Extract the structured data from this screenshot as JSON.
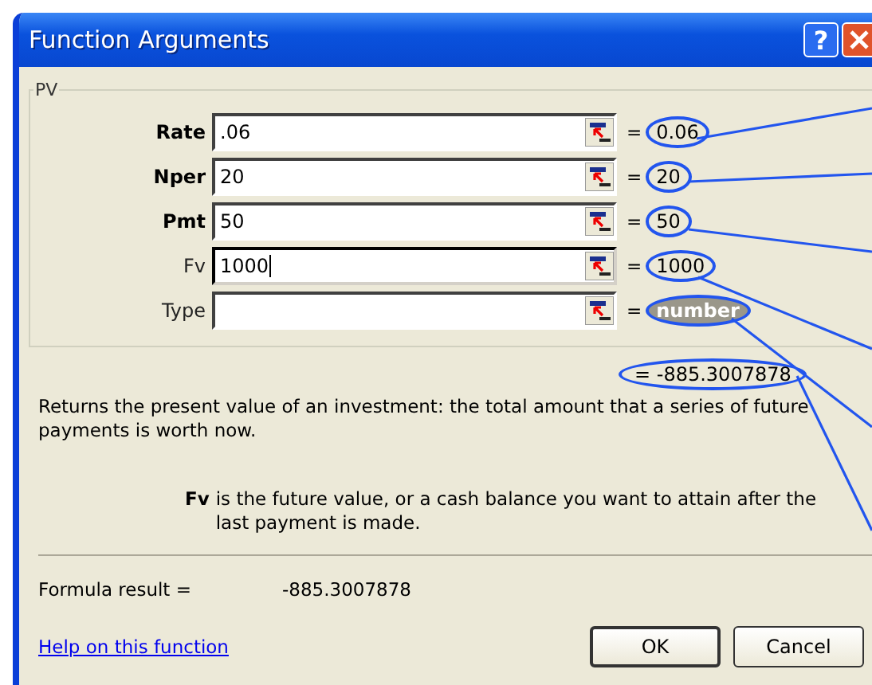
{
  "window": {
    "title": "Function Arguments",
    "help_button": "?"
  },
  "group": {
    "title": "PV",
    "args": [
      {
        "label": "Rate",
        "required": true,
        "value": ".06",
        "focused": false,
        "equals": "=",
        "result": "0.06",
        "result_muted": false
      },
      {
        "label": "Nper",
        "required": true,
        "value": "20",
        "focused": false,
        "equals": "=",
        "result": "20",
        "result_muted": false
      },
      {
        "label": "Pmt",
        "required": true,
        "value": "50",
        "focused": false,
        "equals": "=",
        "result": "50",
        "result_muted": false
      },
      {
        "label": "Fv",
        "required": false,
        "value": "1000",
        "focused": true,
        "equals": "=",
        "result": "1000",
        "result_muted": false
      },
      {
        "label": "Type",
        "required": false,
        "focused": false,
        "equals": "=",
        "result": "number",
        "result_muted": true
      }
    ]
  },
  "function_result": "= -885.3007878",
  "description": "Returns the present value of an investment: the total amount that a series of future payments is worth now.",
  "arg_help": {
    "name": "Fv",
    "text": "is the future value, or a cash balance you want to attain after the last payment is made."
  },
  "formula_result": {
    "label": "Formula result =",
    "value": "-885.3007878"
  },
  "help_link": "Help on this function",
  "buttons": [
    "OK",
    "Cancel"
  ]
}
